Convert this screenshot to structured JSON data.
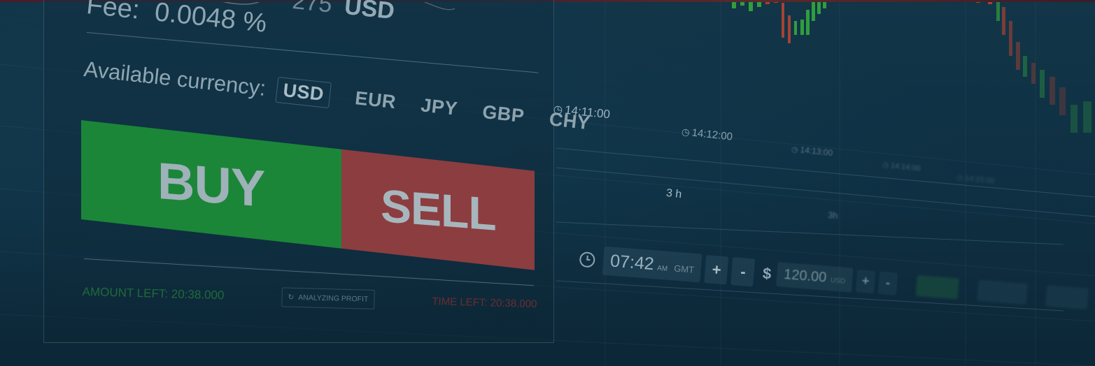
{
  "panel": {
    "fee_label": "Fee:",
    "fee_value": "0.0048 %",
    "partial_amount": "275",
    "partial_currency": "USD",
    "available_label": "Available currency:",
    "currencies": [
      "USD",
      "EUR",
      "JPY",
      "GBP",
      "CHY"
    ],
    "selected_currency": "USD",
    "buy_label": "BUY",
    "sell_label": "SELL",
    "amount_left": "AMOUNT LEFT: 20:38.000",
    "analyzing_label": "ANALYZING PROFIT",
    "time_left": "TIME LEFT: 20:38.000"
  },
  "chart": {
    "time_labels": [
      "14:11:00",
      "14:12:00",
      "14:13:00",
      "14:14:00",
      "14:15:00"
    ],
    "period_labels": [
      "3 h",
      "3h"
    ]
  },
  "controls": {
    "time": "07:42",
    "ampm": "AM",
    "timezone": "GMT",
    "plus": "+",
    "minus": "-",
    "currency_symbol": "$",
    "amount": "120.00",
    "amount_currency": "USD"
  },
  "colors": {
    "buy": "#1b8638",
    "sell": "#8c3d40",
    "background": "#0f3043",
    "candle_up": "#2f9e3e",
    "candle_down": "#a64232"
  }
}
